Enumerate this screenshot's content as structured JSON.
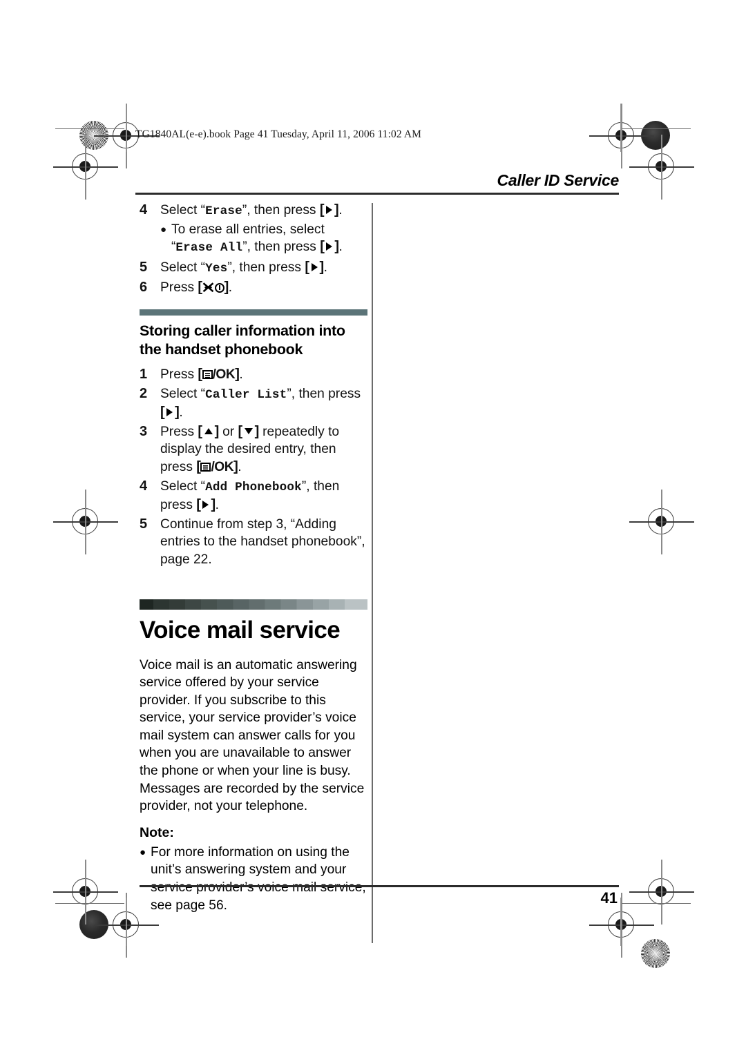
{
  "document": {
    "book_info": "TG1840AL(e-e).book  Page 41  Tuesday, April 11, 2006  11:02 AM",
    "running_head": "Caller ID Service",
    "page_number": "41"
  },
  "colors": {
    "subsection_bar": "#5b7478",
    "section_bar_dark": "#1e2622",
    "section_bar_light": "#bac2c4",
    "rule": "#2b2b2b",
    "column_rule": "#6b6b6b"
  },
  "continued_steps": [
    {
      "number": "4",
      "text_before": "Select “",
      "mono": "Erase",
      "text_after": "”, then press ",
      "key": "right",
      "text_end": ".",
      "sub_bullets": [
        {
          "text_before": "To erase all entries, select “",
          "mono": "Erase All",
          "text_after": "”, then press ",
          "key": "right",
          "text_end": "."
        }
      ]
    },
    {
      "number": "5",
      "text_before": "Select “",
      "mono": "Yes",
      "text_after": "”, then press ",
      "key": "right",
      "text_end": ".",
      "sub_bullets": []
    },
    {
      "number": "6",
      "text_before": "Press ",
      "mono": "",
      "text_after": "",
      "key": "offhook-power",
      "text_end": ".",
      "sub_bullets": []
    }
  ],
  "subsection": {
    "heading": "Storing caller information into the handset phonebook",
    "steps": [
      {
        "number": "1",
        "parts": [
          {
            "type": "text",
            "value": "Press "
          },
          {
            "type": "key",
            "value": "menu-ok"
          },
          {
            "type": "text",
            "value": "."
          }
        ]
      },
      {
        "number": "2",
        "parts": [
          {
            "type": "text",
            "value": "Select “"
          },
          {
            "type": "mono",
            "value": "Caller List"
          },
          {
            "type": "text",
            "value": "”, then press "
          },
          {
            "type": "key",
            "value": "right"
          },
          {
            "type": "text",
            "value": "."
          }
        ]
      },
      {
        "number": "3",
        "parts": [
          {
            "type": "text",
            "value": "Press "
          },
          {
            "type": "key",
            "value": "up"
          },
          {
            "type": "text",
            "value": " or "
          },
          {
            "type": "key",
            "value": "down"
          },
          {
            "type": "text",
            "value": " repeatedly to display the desired entry, then press "
          },
          {
            "type": "key",
            "value": "menu-ok"
          },
          {
            "type": "text",
            "value": "."
          }
        ]
      },
      {
        "number": "4",
        "parts": [
          {
            "type": "text",
            "value": "Select “"
          },
          {
            "type": "mono",
            "value": "Add Phonebook"
          },
          {
            "type": "text",
            "value": "”, then press "
          },
          {
            "type": "key",
            "value": "right"
          },
          {
            "type": "text",
            "value": "."
          }
        ]
      },
      {
        "number": "5",
        "parts": [
          {
            "type": "text",
            "value": "Continue from step 3, “Adding entries to the handset phonebook”, page 22."
          }
        ]
      }
    ]
  },
  "section": {
    "heading": "Voice mail service",
    "body": "Voice mail is an automatic answering service offered by your service provider. If you subscribe to this service, your service provider’s voice mail system can answer calls for you when you are unavailable to answer the phone or when your line is busy. Messages are recorded by the service provider, not your telephone.",
    "note_label": "Note:",
    "note_items": [
      "For more information on using the unit’s answering system and your service provider’s voice mail service, see page 56."
    ]
  }
}
